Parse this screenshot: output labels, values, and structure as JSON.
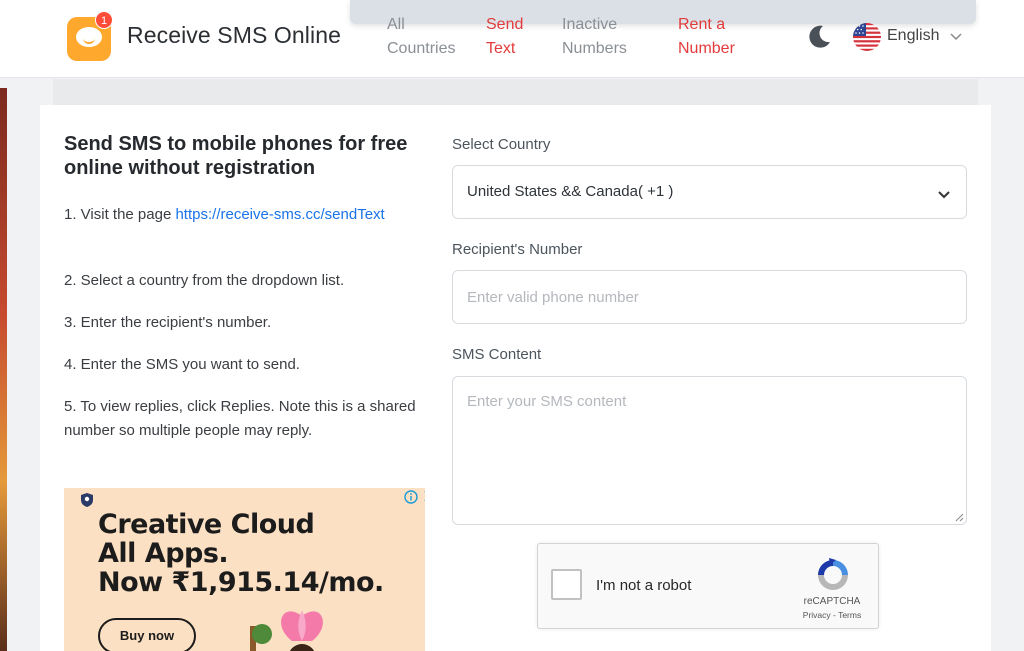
{
  "header": {
    "site_title": "Receive SMS Online",
    "notification_count": "1",
    "nav": [
      {
        "label": "All Countries",
        "active": false
      },
      {
        "label": "Send Text",
        "active": true
      },
      {
        "label": "Inactive Numbers",
        "active": false
      },
      {
        "label": "Rent a Number",
        "active": true
      }
    ],
    "language": "English"
  },
  "intro": {
    "title": "Send SMS to mobile phones for free online without registration",
    "step1_prefix": "1. Visit the page ",
    "step1_link": "https://receive-sms.cc/sendText",
    "step2": "2. Select a country from the dropdown list.",
    "step3": "3. Enter the recipient's number.",
    "step4": "4. Enter the SMS you want to send.",
    "step5": "5. To view replies, click Replies. Note this is a shared number so multiple people may reply."
  },
  "ad": {
    "headline_line1": "Creative Cloud",
    "headline_line2": "All Apps.",
    "headline_line3": "Now ₹1,915.14/mo.",
    "button": "Buy now"
  },
  "form": {
    "country_label": "Select Country",
    "country_value": "United States && Canada( +1 )",
    "number_label": "Recipient's Number",
    "number_placeholder": "Enter valid phone number",
    "content_label": "SMS Content",
    "content_placeholder": "Enter your SMS content"
  },
  "recaptcha": {
    "label": "I'm not a robot",
    "brand": "reCAPTCHA",
    "links": "Privacy - Terms"
  },
  "colors": {
    "accent_red": "#e23b3b",
    "logo_orange": "#ffa82e",
    "link_blue": "#1a73e8"
  }
}
